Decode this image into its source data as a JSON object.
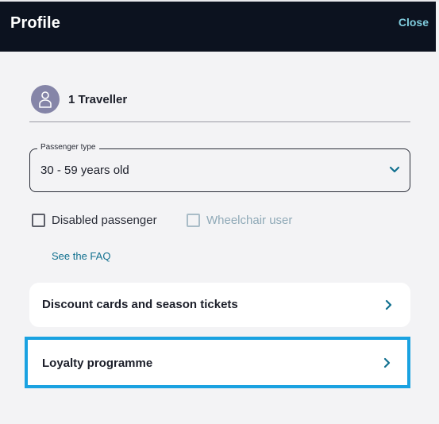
{
  "header": {
    "title": "Profile",
    "close_label": "Close"
  },
  "traveller": {
    "label": "1 Traveller",
    "icon": "person-icon"
  },
  "passenger_type": {
    "legend": "Passenger type",
    "selected": "30 - 59 years old"
  },
  "checkboxes": {
    "disabled_passenger": {
      "label": "Disabled passenger",
      "checked": false,
      "enabled": true
    },
    "wheelchair_user": {
      "label": "Wheelchair user",
      "checked": false,
      "enabled": false
    }
  },
  "faq_link": "See the FAQ",
  "cards": {
    "discount": {
      "label": "Discount cards and season tickets"
    },
    "loyalty": {
      "label": "Loyalty programme",
      "focused": true
    }
  },
  "colors": {
    "header_bg": "#0c121f",
    "accent_link": "#11708f",
    "close_link": "#7fcbdc",
    "focus_outline": "#1aa2e1",
    "avatar_bg": "#8585a8"
  }
}
